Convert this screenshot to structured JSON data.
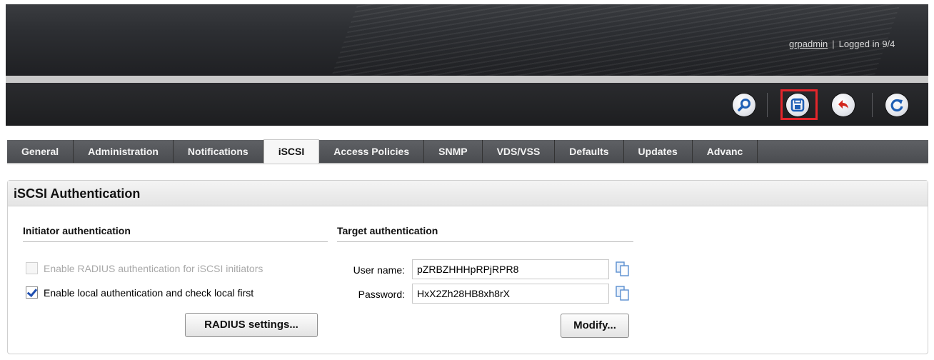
{
  "header": {
    "username": "grpadmin",
    "separator": "|",
    "logged_in": "Logged in 9/4"
  },
  "toolbar": {
    "buttons": [
      {
        "icon": "search-icon"
      },
      {
        "icon": "save-icon",
        "highlighted": true
      },
      {
        "icon": "undo-icon"
      },
      {
        "icon": "refresh-icon"
      }
    ],
    "highlight_color": "#e4262b"
  },
  "tabs": [
    {
      "label": "General"
    },
    {
      "label": "Administration"
    },
    {
      "label": "Notifications"
    },
    {
      "label": "iSCSI",
      "active": true
    },
    {
      "label": "Access Policies"
    },
    {
      "label": "SNMP"
    },
    {
      "label": "VDS/VSS"
    },
    {
      "label": "Defaults"
    },
    {
      "label": "Updates"
    },
    {
      "label": "Advanc"
    }
  ],
  "panel": {
    "title": "iSCSI Authentication",
    "initiator": {
      "title": "Initiator authentication",
      "radius_checkbox": {
        "label": "Enable RADIUS authentication for iSCSI initiators",
        "checked": false,
        "disabled": true
      },
      "local_checkbox": {
        "label": "Enable local authentication and check local first",
        "checked": true
      },
      "radius_button": "RADIUS settings..."
    },
    "target": {
      "title": "Target authentication",
      "username_label": "User name:",
      "username_value": "pZRBZHHHpRPjRPR8",
      "password_label": "Password:",
      "password_value": "HxX2Zh28HB8xh8rX",
      "modify_button": "Modify..."
    }
  }
}
